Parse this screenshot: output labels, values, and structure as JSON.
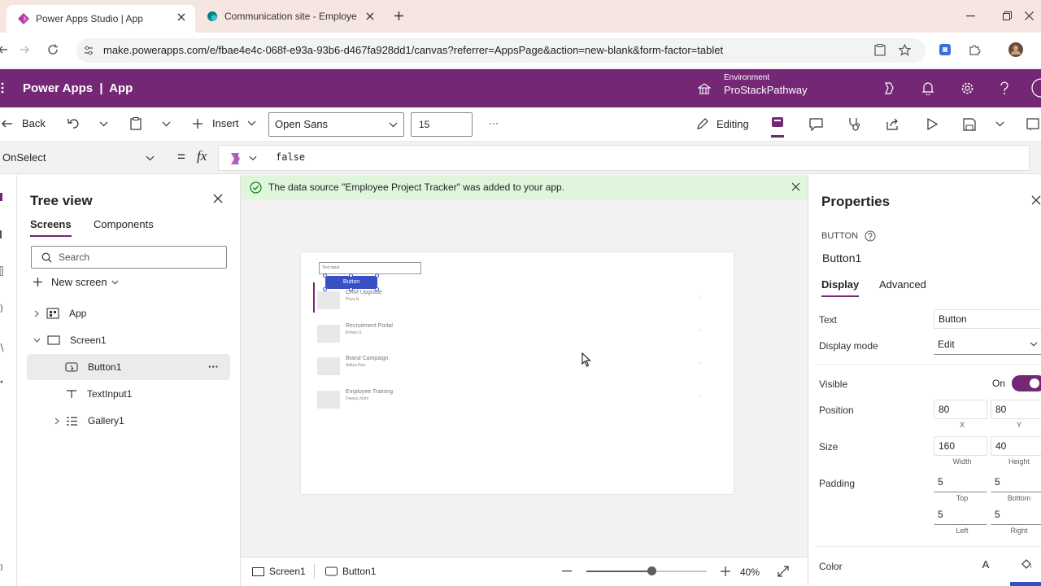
{
  "browser": {
    "tabs": [
      {
        "title": "Power Apps Studio | App",
        "active": true
      },
      {
        "title": "Communication site - Employe",
        "active": false
      }
    ],
    "url": "make.powerapps.com/e/fbae4e4c-068f-e93a-93b6-d467fa928dd1/canvas?referrer=AppsPage&action=new-blank&form-factor=tablet"
  },
  "header": {
    "app_name": "Power Apps",
    "separator": "|",
    "section": "App",
    "env_label": "Environment",
    "env_name": "ProStackPathway"
  },
  "cmdbar": {
    "back": "Back",
    "insert": "Insert",
    "font": "Open Sans",
    "font_size": "15",
    "more": "···",
    "editing": "Editing"
  },
  "formula": {
    "property": "OnSelect",
    "equals": "=",
    "fx": "fx",
    "value": "false"
  },
  "tree": {
    "title": "Tree view",
    "tabs": [
      "Screens",
      "Components"
    ],
    "search_placeholder": "Search",
    "new_screen": "New screen",
    "nodes": [
      {
        "label": "App"
      },
      {
        "label": "Screen1"
      },
      {
        "label": "Button1"
      },
      {
        "label": "TextInput1"
      },
      {
        "label": "Gallery1"
      }
    ],
    "more": "···"
  },
  "canvas": {
    "notice": "The data source \"Employee Project Tracker\" was added to your app.",
    "text_input_label": "Text input",
    "button_label": "Button",
    "gallery": [
      {
        "title": "CRM Upgrade",
        "sub": "Priya N"
      },
      {
        "title": "Recruitment Portal",
        "sub": "Rohan S"
      },
      {
        "title": "Brand Campaign",
        "sub": "Aditya Rao"
      },
      {
        "title": "Employee Training",
        "sub": "Deepa Joshi"
      }
    ]
  },
  "statusbar": {
    "screen": "Screen1",
    "control": "Button1",
    "zoom": "40%",
    "zoom_level": 0.4
  },
  "props": {
    "title": "Properties",
    "type": "BUTTON",
    "name": "Button1",
    "tabs": [
      "Display",
      "Advanced"
    ],
    "text_label": "Text",
    "text_value": "Button",
    "display_mode_label": "Display mode",
    "display_mode_value": "Edit",
    "visible_label": "Visible",
    "visible_value": "On",
    "position_label": "Position",
    "pos_x": "80",
    "pos_y": "80",
    "x_label": "X",
    "y_label": "Y",
    "size_label": "Size",
    "width": "160",
    "height": "40",
    "width_label": "Width",
    "height_label": "Height",
    "padding_label": "Padding",
    "pad_top": "5",
    "pad_bottom": "5",
    "pad_left": "5",
    "pad_right": "5",
    "top_label": "Top",
    "bottom_label": "Bottom",
    "left_label": "Left",
    "right_label": "Right",
    "color_label": "Color",
    "color_a": "A"
  },
  "colors": {
    "brand": "#742774",
    "accent_button": "#3b4fc4",
    "notice_bg": "#dff6dd",
    "toggle_on": "#742774"
  }
}
